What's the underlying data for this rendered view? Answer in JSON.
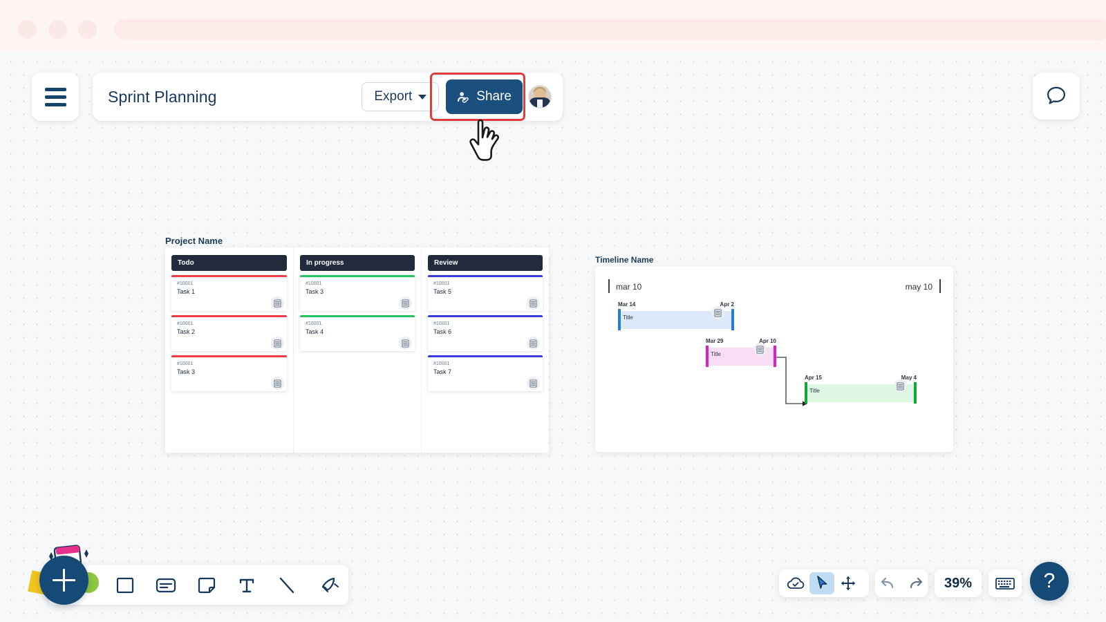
{
  "browser": {
    "dots": [
      "chrome-dot-close",
      "chrome-dot-minimize",
      "chrome-dot-maximize"
    ],
    "address_value": ""
  },
  "topbar": {
    "menu_icon": "hamburger-icon",
    "title": "Sprint Planning",
    "export_label": "Export",
    "export_caret_icon": "chevron-down-icon",
    "share_label": "Share",
    "share_icon": "person-attach-icon",
    "avatar_icon": "user-avatar",
    "comment_icon": "speech-bubble-icon",
    "highlight_color": "#e23b3b",
    "share_bg": "#1b4f7e"
  },
  "cursor": {
    "icon": "pointing-hand-cursor"
  },
  "kanban": {
    "label": "Project Name",
    "columns": [
      {
        "title": "Todo",
        "accent": "#ef3b46",
        "cards": [
          {
            "id": "#10001",
            "title": "Task 1",
            "icon": "database-icon"
          },
          {
            "id": "#10001",
            "title": "Task 2",
            "icon": "database-icon"
          },
          {
            "id": "#10001",
            "title": "Task 3",
            "icon": "database-icon"
          }
        ]
      },
      {
        "title": "In progress",
        "accent": "#22c55e",
        "cards": [
          {
            "id": "#10001",
            "title": "Task 3",
            "icon": "database-icon"
          },
          {
            "id": "#10001",
            "title": "Task 4",
            "icon": "database-icon"
          }
        ]
      },
      {
        "title": "Review",
        "accent": "#3b3bdd",
        "cards": [
          {
            "id": "#10001",
            "title": "Task 5",
            "icon": "database-icon"
          },
          {
            "id": "#10001",
            "title": "Task 6",
            "icon": "database-icon"
          },
          {
            "id": "#10001",
            "title": "Task 7",
            "icon": "database-icon"
          }
        ]
      }
    ]
  },
  "timeline": {
    "label": "Timeline Name",
    "axis_start": "mar 10",
    "axis_end": "may 10",
    "tasks": [
      {
        "title": "Title",
        "start_date": "Mar 14",
        "end_date": "Apr 2",
        "fill": "#dbe9fb",
        "cap": "#2a7bd4",
        "icon": "database-icon"
      },
      {
        "title": "Title",
        "start_date": "Mar 29",
        "end_date": "Apr 10",
        "fill": "#fbdcf5",
        "cap": "#e020c0",
        "icon": "database-icon"
      },
      {
        "title": "Title",
        "start_date": "Apr 15",
        "end_date": "May 4",
        "fill": "#ddf7e3",
        "cap": "#0faa35",
        "icon": "database-icon"
      }
    ]
  },
  "left_toolbar": {
    "add_label": "+",
    "tools": [
      {
        "name": "shape-square-icon",
        "label": "Shape"
      },
      {
        "name": "card-icon",
        "label": "Card"
      },
      {
        "name": "sticky-note-icon",
        "label": "Sticky note"
      },
      {
        "name": "text-icon",
        "label": "Text"
      },
      {
        "name": "line-icon",
        "label": "Line"
      },
      {
        "name": "pen-icon",
        "label": "Pen"
      }
    ]
  },
  "right_toolbar": {
    "cloud_icon": "cloud-saved-icon",
    "select_icon": "cursor-select-icon",
    "pan_icon": "move-pan-icon",
    "undo_icon": "undo-icon",
    "redo_icon": "redo-icon",
    "zoom_level": "39%",
    "keyboard_icon": "keyboard-icon",
    "help_label": "?"
  }
}
